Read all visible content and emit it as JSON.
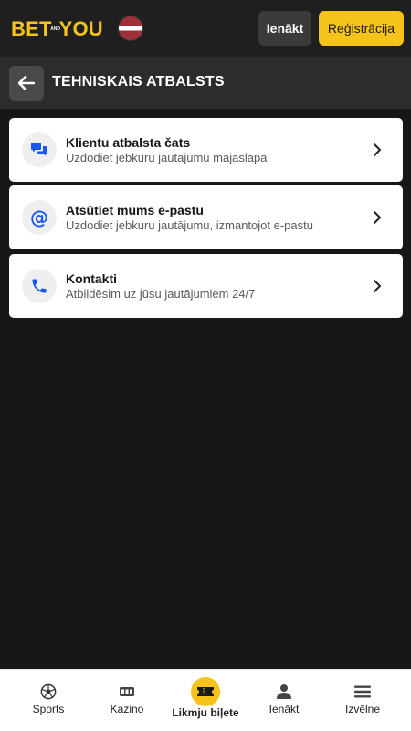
{
  "header": {
    "logo_bet": "BET",
    "logo_and": "AND",
    "logo_you": "YOU",
    "login_label": "Ienākt",
    "register_label": "Reģistrācija",
    "flag": "latvia-flag"
  },
  "page": {
    "title": "TEHNISKAIS ATBALSTS"
  },
  "support_options": [
    {
      "icon": "chat-icon",
      "title": "Klientu atbalsta čats",
      "subtitle": "Uzdodiet jebkuru jautājumu mājaslapā"
    },
    {
      "icon": "at-icon",
      "title": "Atsūtiet mums e-pastu",
      "subtitle": "Uzdodiet jebkuru jautājumu, izmantojot e-pastu"
    },
    {
      "icon": "phone-icon",
      "title": "Kontakti",
      "subtitle": "Atbildēsim uz jūsu jautājumiem 24/7"
    }
  ],
  "bottom_nav": [
    {
      "label": "Sports",
      "icon": "soccer-ball-icon"
    },
    {
      "label": "Kazino",
      "icon": "slot-machine-icon"
    },
    {
      "label": "Likmju biļete",
      "icon": "ticket-icon",
      "active": true
    },
    {
      "label": "Ienākt",
      "icon": "user-icon"
    },
    {
      "label": "Izvēlne",
      "icon": "menu-icon"
    }
  ],
  "colors": {
    "accent": "#f6c31a",
    "background": "#171717",
    "icon_blue": "#1a56f0"
  }
}
